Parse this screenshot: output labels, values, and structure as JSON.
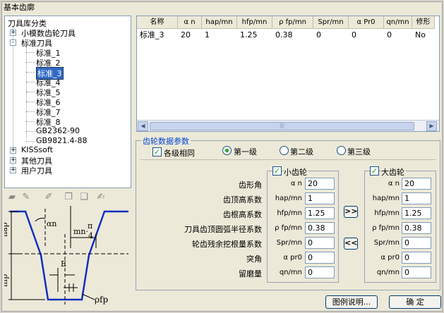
{
  "window": {
    "title": "基本齿廓"
  },
  "tree": {
    "root": "刀具库分类",
    "groups": [
      {
        "label": "小模数齿轮刀具",
        "expander": "+"
      },
      {
        "label": "标准刀具",
        "expander": "-"
      },
      {
        "label": "KISSsoft",
        "expander": "+"
      },
      {
        "label": "其他刀具",
        "expander": "+"
      },
      {
        "label": "用户刀具",
        "expander": "+"
      }
    ],
    "children": [
      "标准_1",
      "标准_2",
      "标准_3",
      "标准_4",
      "标准_5",
      "标准_6",
      "标准_7",
      "标准_8",
      "GB2362-90",
      "GB9821.4-88"
    ],
    "selected": "标准_3"
  },
  "toolbar": {
    "icons": [
      "new-folder-icon",
      "edit-folder-icon",
      "edit-pen-icon",
      "new-file-icon",
      "copy-file-icon",
      "edit-file-icon"
    ]
  },
  "table": {
    "columns": [
      "名称",
      "α n",
      "hap/mn",
      "hfp/mn",
      "ρ fp/mn",
      "Spr/mn",
      "α Pr0",
      "qn/mn",
      "修形"
    ],
    "rows": [
      [
        "标准_3",
        "20",
        "1",
        "1.25",
        "0.38",
        "0",
        "0",
        "0",
        "No"
      ]
    ],
    "scroll_left": "◀",
    "scroll_right": "▶",
    "scroll_grip": "|||"
  },
  "params": {
    "section_title": "齿轮数据参数",
    "all_levels_label": "各级相同",
    "all_levels_checked": true,
    "levels": [
      "第一级",
      "第二级",
      "第三级"
    ],
    "selected_level": "第一级",
    "row_labels": [
      "齿形角",
      "齿顶高系数",
      "齿根高系数",
      "刀具齿顶圆弧半径系数",
      "轮齿残余挖根量系数",
      "突角",
      "留磨量"
    ],
    "symbols": [
      "α n",
      "hap/mn",
      "hfp/mn",
      "ρ fp/mn",
      "Spr/mn",
      "α pr0",
      "qn/mn"
    ],
    "small_gear": {
      "label": "小齿轮",
      "checked": true,
      "values": [
        "20",
        "1",
        "1.25",
        "0.38",
        "0",
        "0",
        "0"
      ]
    },
    "large_gear": {
      "label": "大齿轮",
      "checked": true,
      "values": [
        "20",
        "1",
        "1.25",
        "0.38",
        "0",
        "0",
        "0"
      ]
    },
    "copy_right_label": ">>",
    "copy_left_label": "<<"
  },
  "diagram": {
    "labels": {
      "hap": "hap",
      "hfp": "hfp",
      "an": "αn",
      "mn": "mn·",
      "pi": "π",
      "four": "4",
      "E": "E",
      "rho": "ρfp"
    }
  },
  "buttons": {
    "legend": "图例说明...",
    "ok": "确  定"
  }
}
